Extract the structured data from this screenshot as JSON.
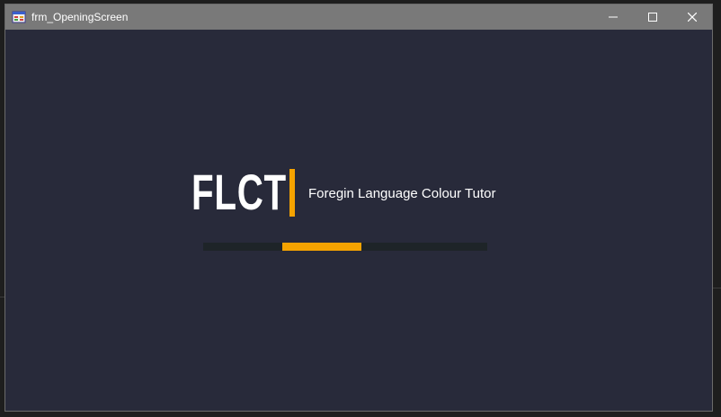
{
  "window": {
    "title": "frm_OpeningScreen",
    "icon": "form-icon",
    "controls": {
      "minimize_icon": "minimize-icon",
      "maximize_icon": "maximize-icon",
      "close_icon": "close-icon"
    }
  },
  "splash": {
    "logo": "FLCT",
    "subtitle": "Foregin Language Colour Tutor"
  },
  "loader": {
    "segment_start": 0.28,
    "segment_end": 0.56
  },
  "colors": {
    "accent": "#f5a300",
    "background": "#282a3a",
    "titlebar": "#797979",
    "track": "#1e2428",
    "text": "#ffffff"
  }
}
